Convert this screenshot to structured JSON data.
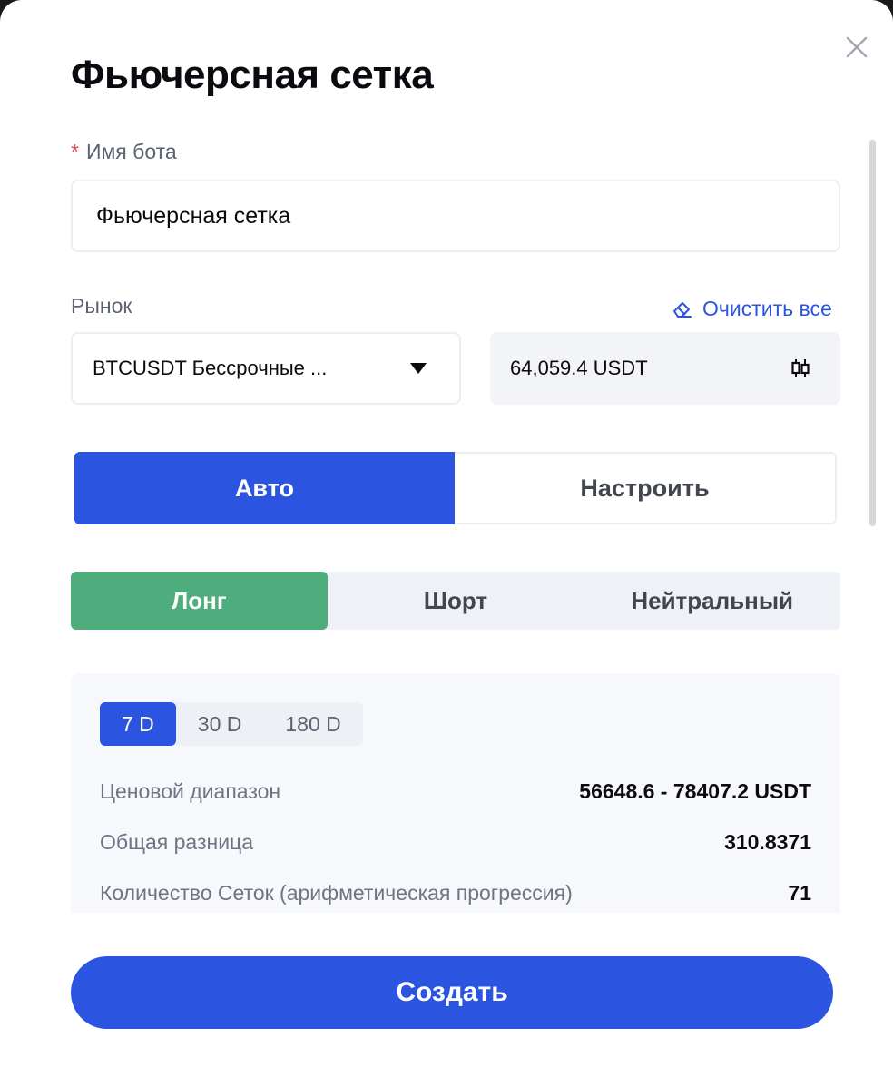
{
  "modal": {
    "title": "Фьючерсная сетка",
    "close_icon": "close-icon"
  },
  "bot_name": {
    "required_mark": "*",
    "label": "Имя бота",
    "value": "Фьючерсная сетка"
  },
  "market": {
    "label": "Рынок",
    "clear_all": "Очистить все",
    "clear_icon": "eraser-icon",
    "selected": "BTCUSDT Бессрочные ...",
    "price": "64,059.4 USDT",
    "price_icon": "candlestick-icon"
  },
  "mode_tabs": [
    {
      "label": "Авто",
      "active": true
    },
    {
      "label": "Настроить",
      "active": false
    }
  ],
  "direction_tabs": [
    {
      "label": "Лонг",
      "active": true
    },
    {
      "label": "Шорт",
      "active": false
    },
    {
      "label": "Нейтральный",
      "active": false
    }
  ],
  "period_tabs": [
    {
      "label": "7 D",
      "active": true
    },
    {
      "label": "30 D",
      "active": false
    },
    {
      "label": "180 D",
      "active": false
    }
  ],
  "stats": [
    {
      "label": "Ценовой диапазон",
      "value": "56648.6 - 78407.2 USDT"
    },
    {
      "label": "Общая разница",
      "value": "310.8371"
    },
    {
      "label": "Количество Сеток (арифметическая прогрессия)",
      "value": "71"
    }
  ],
  "create_button": "Создать",
  "colors": {
    "accent": "#2b55e0",
    "long_green": "#4fac7c",
    "required_red": "#e54848"
  }
}
